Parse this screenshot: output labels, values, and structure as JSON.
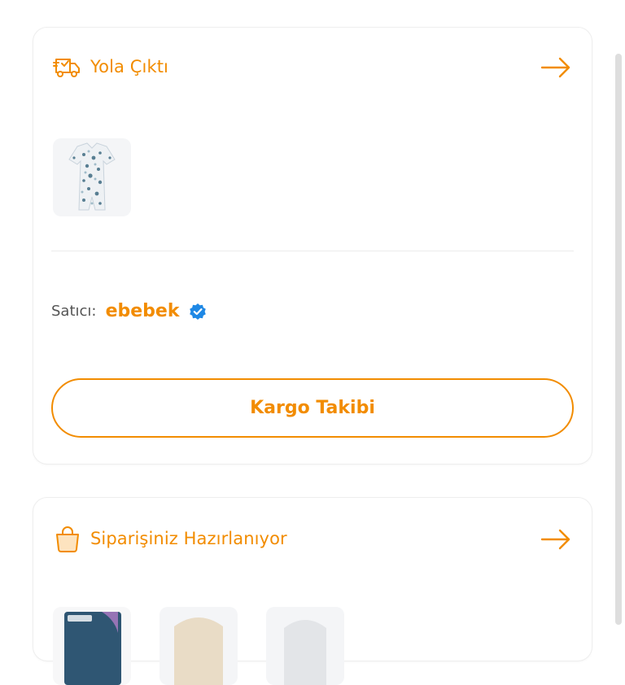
{
  "shipped_card": {
    "title": "Yola Çıktı",
    "icon": "delivery-truck-icon",
    "seller_label": "Satıcı:",
    "seller_name": "ebebek",
    "track_button": "Kargo Takibi",
    "accent": "#f28c00",
    "verified_color": "#1e88e5"
  },
  "preparing_card": {
    "title": "Siparişiniz Hazırlanıyor",
    "icon": "shopping-bag-icon"
  }
}
